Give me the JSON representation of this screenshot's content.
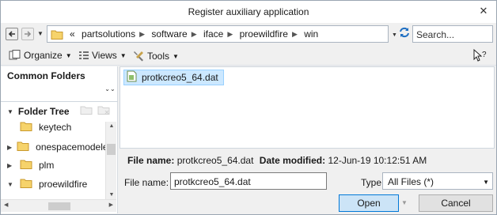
{
  "window": {
    "title": "Register auxiliary application",
    "close_label": "✕"
  },
  "nav": {
    "back_icon": "back-arrow-icon",
    "forward_icon": "forward-arrow-icon",
    "breadcrumb_prefix": "«",
    "breadcrumbs": [
      "partsolutions",
      "software",
      "iface",
      "proewildfire",
      "win"
    ],
    "search_placeholder": "Search..."
  },
  "toolbar": {
    "organize": "Organize",
    "views": "Views",
    "tools": "Tools"
  },
  "sidebar": {
    "common_folders": "Common Folders",
    "folder_tree": "Folder Tree",
    "items": [
      {
        "label": "keytech",
        "expander": ""
      },
      {
        "label": "onespacemodeler",
        "expander": "▶"
      },
      {
        "label": "plm",
        "expander": "▶"
      },
      {
        "label": "proewildfire",
        "expander": "▼"
      }
    ]
  },
  "files": [
    {
      "name": "protkcreo5_64.dat",
      "selected": true
    }
  ],
  "details": {
    "file_name_label": "File name:",
    "file_name_value": "protkcreo5_64.dat",
    "date_modified_label": "Date modified:",
    "date_modified_value": "12-Jun-19 10:12:51 AM"
  },
  "form": {
    "file_name_label": "File name:",
    "file_name_value": "protkcreo5_64.dat",
    "type_label": "Type",
    "type_value": "All Files (*)"
  },
  "buttons": {
    "open": "Open",
    "cancel": "Cancel"
  },
  "colors": {
    "selection": "#cce8ff",
    "folder": "#e8b84a",
    "accent": "#0078d7"
  }
}
